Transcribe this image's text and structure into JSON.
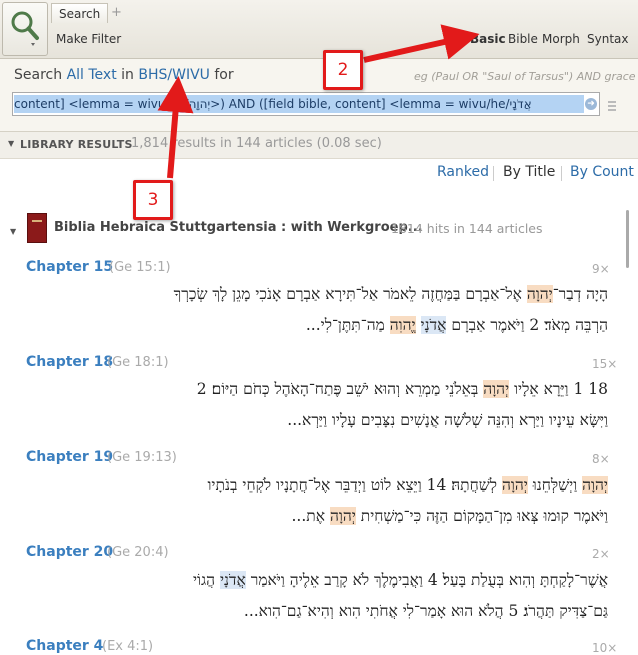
{
  "toolbar": {
    "tab_label": "Search",
    "add_tab": "+",
    "make_filter": "Make Filter",
    "modes": [
      "Basic",
      "Bible",
      "Morph",
      "Syntax"
    ]
  },
  "search": {
    "prefix": "Search",
    "scope": "All Text",
    "in": "in",
    "resource": "BHS/WIVU",
    "for": "for",
    "example": "eg (Paul OR \"Saul of Tarsus\") AND grace",
    "query": "content] <lemma = wivu/he/יְהוָה>) AND ([field bible, content] <lemma = wivu/he/אֲדֹנָי"
  },
  "results": {
    "label": "LIBRARY RESULTS",
    "summary": "1,814 results in 144 articles (0.08 sec)"
  },
  "sort": {
    "ranked": "Ranked",
    "by_title": "By Title",
    "by_count": "By Count"
  },
  "book": {
    "title": "Biblia Hebraica Stuttgartensia : with Werkgroep...",
    "hits": "1814 hits in 144 articles"
  },
  "chapters": [
    {
      "label": "Chapter 15",
      "ref": "(Ge 15:1)",
      "count": "9×",
      "line1": [
        {
          "t": "הָיָה דְבַר־",
          "h": ""
        },
        {
          "t": "יְהוָה",
          "h": "o"
        },
        {
          "t": " אֶל־אַבְרָם בַּמַּחֲזֶה לֵאמֹר אַל־תִּירָא אַבְרָם אָנֹכִי מָגֵן לָךְ שְׂכָרְךָ",
          "h": ""
        }
      ],
      "line2": [
        {
          "t": "הַרְבֵּה מְאֹד׃ 2 וַיֹּאמֶר אַבְרָם ",
          "h": ""
        },
        {
          "t": "אֲדֹנָי",
          "h": "b"
        },
        {
          "t": " ",
          "h": ""
        },
        {
          "t": "יֱהוִה",
          "h": "o"
        },
        {
          "t": " מַה־תִּתֶּן־לִי...",
          "h": ""
        }
      ]
    },
    {
      "label": "Chapter 18",
      "ref": "(Ge 18:1)",
      "count": "15×",
      "line1": [
        {
          "t": "18 1 וַיֵּרָא אֵלָיו ",
          "h": ""
        },
        {
          "t": "יְהוָה",
          "h": "o"
        },
        {
          "t": " בְּאֵלֹנֵי מַמְרֵא וְהוּא יֹשֵׁב פֶּתַח־הָאֹהֶל כְּחֹם הַיּוֹם׃ 2",
          "h": ""
        }
      ],
      "line2": [
        {
          "t": "וַיִּשָּׂא עֵינָיו וַיַּרְא וְהִנֵּה שְׁלֹשָׁה אֲנָשִׁים נִצָּבִים עָלָיו וַיַּרְא...",
          "h": ""
        }
      ]
    },
    {
      "label": "Chapter 19",
      "ref": "(Ge 19:13)",
      "count": "8×",
      "line1": [
        {
          "t": "יְהוָה",
          "h": "o"
        },
        {
          "t": " וַיְשַׁלְּחֵנוּ ",
          "h": ""
        },
        {
          "t": "יְהוָה",
          "h": "o"
        },
        {
          "t": " לְשַׁחֲתָהּ׃ 14 וַיֵּצֵא לוֹט וַיְדַבֵּר אֶל־חֲתָנָיו לֹקְחֵי בְנֹתָיו",
          "h": ""
        }
      ],
      "line2": [
        {
          "t": "וַיֹּאמֶר קוּמוּ צְּאוּ מִן־הַמָּקוֹם הַזֶּה כִּי־מַשְׁחִית ",
          "h": ""
        },
        {
          "t": "יְהוָה",
          "h": "o"
        },
        {
          "t": " אֶת...",
          "h": ""
        }
      ]
    },
    {
      "label": "Chapter 20",
      "ref": "(Ge 20:4)",
      "count": "2×",
      "line1": [
        {
          "t": "אֲשֶׁר־לָקַחְתָּ וְהִוא בְּעֻלַת בָּעַל׃ 4 וַאֲבִימֶלֶךְ לֹא קָרַב אֵלֶיהָ וַיֹּאמַר ",
          "h": ""
        },
        {
          "t": "אֲדֹנָי",
          "h": "b"
        },
        {
          "t": " הֲגוֹי",
          "h": ""
        }
      ],
      "line2": [
        {
          "t": "גַּם־צַדִּיק תַּהֲרֹג׃ 5 הֲלֹא הוּא אָמַר־לִי אֲחֹתִי הִוא וְהִיא־גַם־הִוא...",
          "h": ""
        }
      ]
    },
    {
      "label": "Chapter 4",
      "ref": "(Ex 4:1)",
      "count": "10×"
    }
  ],
  "callouts": [
    "2",
    "3"
  ],
  "colors": {
    "annotation": "#e21a1a",
    "link": "#2d6ca8",
    "highlight_yhwh": "#f8dcc2",
    "highlight_adonai": "#dbe7f5"
  }
}
